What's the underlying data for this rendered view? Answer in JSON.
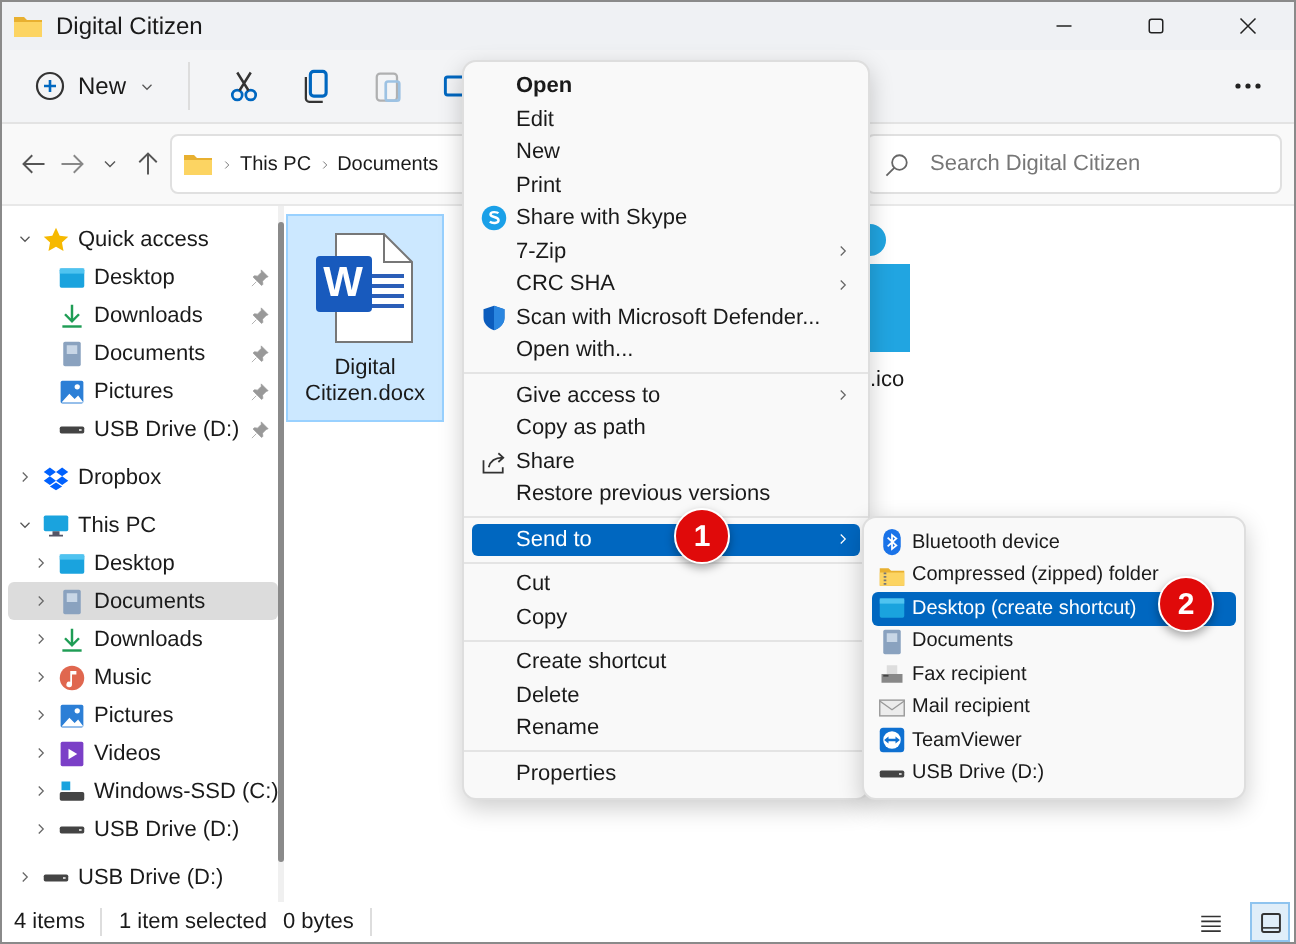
{
  "window": {
    "title": "Digital Citizen"
  },
  "toolbar": {
    "new_button": "New",
    "tools": [
      {
        "kind": "cut",
        "disabled": false
      },
      {
        "kind": "copy",
        "disabled": false
      },
      {
        "kind": "paste",
        "disabled": true
      },
      {
        "kind": "rename",
        "disabled": false
      }
    ]
  },
  "address_bar": {
    "crumbs": [
      "This PC",
      "Documents"
    ]
  },
  "search": {
    "placeholder": "Search Digital Citizen"
  },
  "sidebar": {
    "items": [
      {
        "label": "Quick access",
        "kind": "star",
        "expanded": true,
        "selected": false,
        "children": [
          {
            "label": "Desktop",
            "kind": "desktop",
            "pinned": true,
            "selected": false
          },
          {
            "label": "Downloads",
            "kind": "downloads",
            "pinned": true,
            "selected": false
          },
          {
            "label": "Documents",
            "kind": "documents",
            "pinned": true,
            "selected": false
          },
          {
            "label": "Pictures",
            "kind": "pictures",
            "pinned": true,
            "selected": false
          },
          {
            "label": "USB Drive (D:)",
            "kind": "usb",
            "pinned": true,
            "selected": false
          }
        ]
      },
      {
        "label": "Dropbox",
        "kind": "dropbox",
        "expanded": false,
        "selected": false
      },
      {
        "label": "This PC",
        "kind": "pc",
        "expanded": true,
        "selected": false,
        "children": [
          {
            "label": "Desktop",
            "kind": "desktop",
            "expanded": false,
            "selected": false
          },
          {
            "label": "Documents",
            "kind": "documents",
            "expanded": false,
            "selected": true
          },
          {
            "label": "Downloads",
            "kind": "downloads",
            "expanded": false,
            "selected": false
          },
          {
            "label": "Music",
            "kind": "music",
            "expanded": false,
            "selected": false
          },
          {
            "label": "Pictures",
            "kind": "pictures",
            "expanded": false,
            "selected": false
          },
          {
            "label": "Videos",
            "kind": "videos",
            "expanded": false,
            "selected": false
          },
          {
            "label": "Windows-SSD (C:)",
            "kind": "drive",
            "expanded": false,
            "selected": false
          },
          {
            "label": "USB Drive (D:)",
            "kind": "usb",
            "expanded": false,
            "selected": false
          }
        ]
      },
      {
        "label": "USB Drive (D:)",
        "kind": "usb",
        "expanded": false,
        "selected": false
      }
    ]
  },
  "files": [
    {
      "name": "Digital Citizen.docx",
      "kind": "word",
      "icon_letter": "W",
      "selected": true
    },
    {
      "name": ".ico",
      "kind": "logo",
      "selected": false
    }
  ],
  "context_menu": {
    "groups": [
      [
        {
          "label": "Open",
          "kind": "plain",
          "default": true,
          "submenu": false,
          "selected": false
        },
        {
          "label": "Edit",
          "kind": "plain",
          "default": false,
          "submenu": false,
          "selected": false
        },
        {
          "label": "New",
          "kind": "plain",
          "default": false,
          "submenu": false,
          "selected": false
        },
        {
          "label": "Print",
          "kind": "plain",
          "default": false,
          "submenu": false,
          "selected": false
        },
        {
          "label": "Share with Skype",
          "kind": "skype",
          "default": false,
          "submenu": false,
          "selected": false
        },
        {
          "label": "7-Zip",
          "kind": "plain",
          "default": false,
          "submenu": true,
          "selected": false
        },
        {
          "label": "CRC SHA",
          "kind": "plain",
          "default": false,
          "submenu": true,
          "selected": false
        },
        {
          "label": "Scan with Microsoft Defender...",
          "kind": "shield",
          "default": false,
          "submenu": false,
          "selected": false
        },
        {
          "label": "Open with...",
          "kind": "plain",
          "default": false,
          "submenu": false,
          "selected": false
        }
      ],
      [
        {
          "label": "Give access to",
          "kind": "plain",
          "default": false,
          "submenu": true,
          "selected": false
        },
        {
          "label": "Copy as path",
          "kind": "plain",
          "default": false,
          "submenu": false,
          "selected": false
        },
        {
          "label": "Share",
          "kind": "share",
          "default": false,
          "submenu": false,
          "selected": false
        },
        {
          "label": "Restore previous versions",
          "kind": "plain",
          "default": false,
          "submenu": false,
          "selected": false
        }
      ],
      [
        {
          "label": "Send to",
          "kind": "plain",
          "default": false,
          "submenu": true,
          "selected": true
        }
      ],
      [
        {
          "label": "Cut",
          "kind": "plain",
          "default": false,
          "submenu": false,
          "selected": false
        },
        {
          "label": "Copy",
          "kind": "plain",
          "default": false,
          "submenu": false,
          "selected": false
        }
      ],
      [
        {
          "label": "Create shortcut",
          "kind": "plain",
          "default": false,
          "submenu": false,
          "selected": false
        },
        {
          "label": "Delete",
          "kind": "plain",
          "default": false,
          "submenu": false,
          "selected": false
        },
        {
          "label": "Rename",
          "kind": "plain",
          "default": false,
          "submenu": false,
          "selected": false
        }
      ],
      [
        {
          "label": "Properties",
          "kind": "plain",
          "default": false,
          "submenu": false,
          "selected": false
        }
      ]
    ]
  },
  "send_to_menu": {
    "items": [
      {
        "label": "Bluetooth device",
        "kind": "bluetooth",
        "selected": false
      },
      {
        "label": "Compressed (zipped) folder",
        "kind": "zip",
        "selected": false
      },
      {
        "label": "Desktop (create shortcut)",
        "kind": "desktop",
        "selected": true
      },
      {
        "label": "Documents",
        "kind": "documents",
        "selected": false
      },
      {
        "label": "Fax recipient",
        "kind": "fax",
        "selected": false
      },
      {
        "label": "Mail recipient",
        "kind": "mail",
        "selected": false
      },
      {
        "label": "TeamViewer",
        "kind": "teamviewer",
        "selected": false
      },
      {
        "label": "USB Drive (D:)",
        "kind": "usb",
        "selected": false
      }
    ]
  },
  "callouts": [
    "1",
    "2"
  ],
  "status_bar": {
    "count": "4 items",
    "selection": "1 item selected",
    "size": "0 bytes",
    "views": [
      {
        "kind": "details",
        "selected": false
      },
      {
        "kind": "tiles",
        "selected": true
      }
    ]
  }
}
